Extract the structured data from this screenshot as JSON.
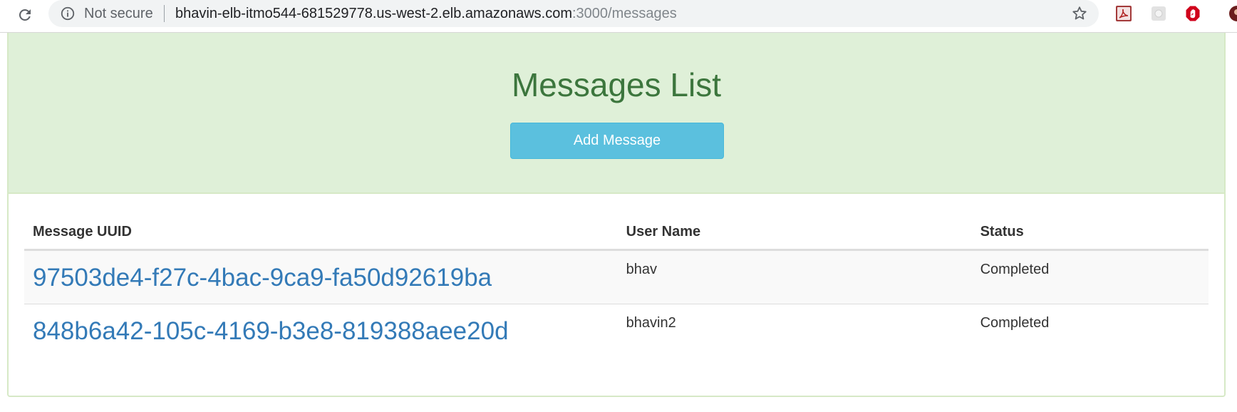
{
  "browser": {
    "security_label": "Not secure",
    "url_host": "bhavin-elb-itmo544-681529778.us-west-2.elb.amazonaws.com",
    "url_rest": ":3000/messages",
    "icons": [
      "reload-icon",
      "info-icon",
      "star-icon",
      "pdf-extension-icon",
      "extension-icon",
      "adblock-stop-icon",
      "profile-avatar-icon"
    ]
  },
  "header": {
    "title": "Messages List",
    "add_button_label": "Add Message"
  },
  "table": {
    "columns": [
      "Message UUID",
      "User Name",
      "Status"
    ],
    "rows": [
      {
        "uuid": "97503de4-f27c-4bac-9ca9-fa50d92619ba",
        "user_name": "bhav",
        "status": "Completed"
      },
      {
        "uuid": "848b6a42-105c-4169-b3e8-819388aee20d",
        "user_name": "bhavin2",
        "status": "Completed"
      }
    ]
  },
  "colors": {
    "jumbotron_bg": "#dff0d8",
    "title_green": "#3c763d",
    "button_info": "#5bc0de",
    "link_blue": "#337ab7"
  }
}
